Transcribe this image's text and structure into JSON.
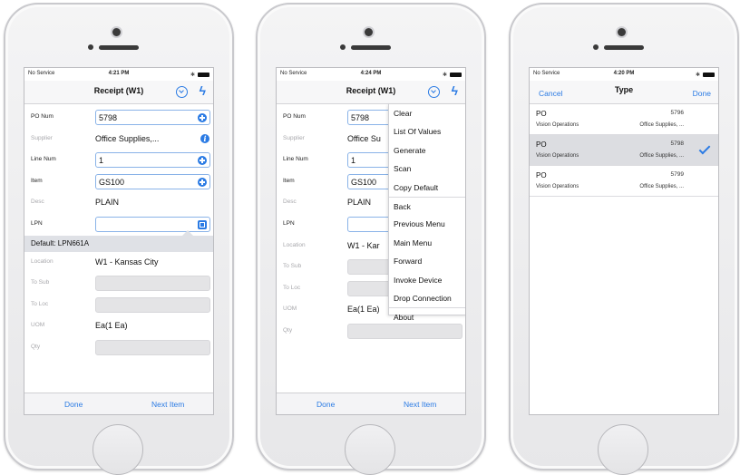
{
  "status": {
    "carrier": "No Service",
    "battery_text": ""
  },
  "screen1": {
    "time": "4:21 PM",
    "title": "Receipt (W1)",
    "fields": [
      {
        "label": "PO Num",
        "value": "5798"
      },
      {
        "label": "Supplier",
        "value": "Office Supplies,..."
      },
      {
        "label": "Line Num",
        "value": "1"
      },
      {
        "label": "Item",
        "value": "GS100"
      },
      {
        "label": "Desc",
        "value": "PLAIN"
      },
      {
        "label": "LPN",
        "value": ""
      }
    ],
    "tooltip": "Default: LPN661A",
    "fields2": [
      {
        "label": "Location",
        "value": "W1 - Kansas City"
      },
      {
        "label": "To Sub",
        "value": ""
      },
      {
        "label": "To Loc",
        "value": ""
      },
      {
        "label": "UOM",
        "value": "Ea(1 Ea)"
      },
      {
        "label": "Qty",
        "value": ""
      }
    ],
    "buttons": {
      "done": "Done",
      "next": "Next Item"
    }
  },
  "screen2": {
    "time": "4:24 PM",
    "title": "Receipt (W1)",
    "fields": [
      {
        "label": "PO Num",
        "value": "5798"
      },
      {
        "label": "Supplier",
        "value": "Office Su"
      },
      {
        "label": "Line Num",
        "value": "1"
      },
      {
        "label": "Item",
        "value": "GS100"
      },
      {
        "label": "Desc",
        "value": "PLAIN"
      },
      {
        "label": "LPN",
        "value": ""
      },
      {
        "label": "Location",
        "value": "W1 - Kar"
      },
      {
        "label": "To Sub",
        "value": ""
      },
      {
        "label": "To Loc",
        "value": ""
      },
      {
        "label": "UOM",
        "value": "Ea(1 Ea)"
      },
      {
        "label": "Qty",
        "value": ""
      }
    ],
    "menu": [
      "Clear",
      "List Of Values",
      "Generate",
      "Scan",
      "Copy Default",
      "Back",
      "Previous Menu",
      "Main Menu",
      "Forward",
      "Invoke Device",
      "Drop Connection",
      "About"
    ],
    "buttons": {
      "done": "Done",
      "next": "Next Item"
    }
  },
  "screen3": {
    "time": "4:20 PM",
    "cancel": "Cancel",
    "title": "Type",
    "done": "Done",
    "rows": [
      {
        "type": "PO",
        "org": "Vision Operations",
        "num": "5796",
        "supplier": "Office Supplies, ..."
      },
      {
        "type": "PO",
        "org": "Vision Operations",
        "num": "5798",
        "supplier": "Office Supplies, ..."
      },
      {
        "type": "PO",
        "org": "Vision Operations",
        "num": "5799",
        "supplier": "Office Supplies, ..."
      }
    ],
    "selected_index": 1
  },
  "colors": {
    "accent": "#2b7be4"
  }
}
